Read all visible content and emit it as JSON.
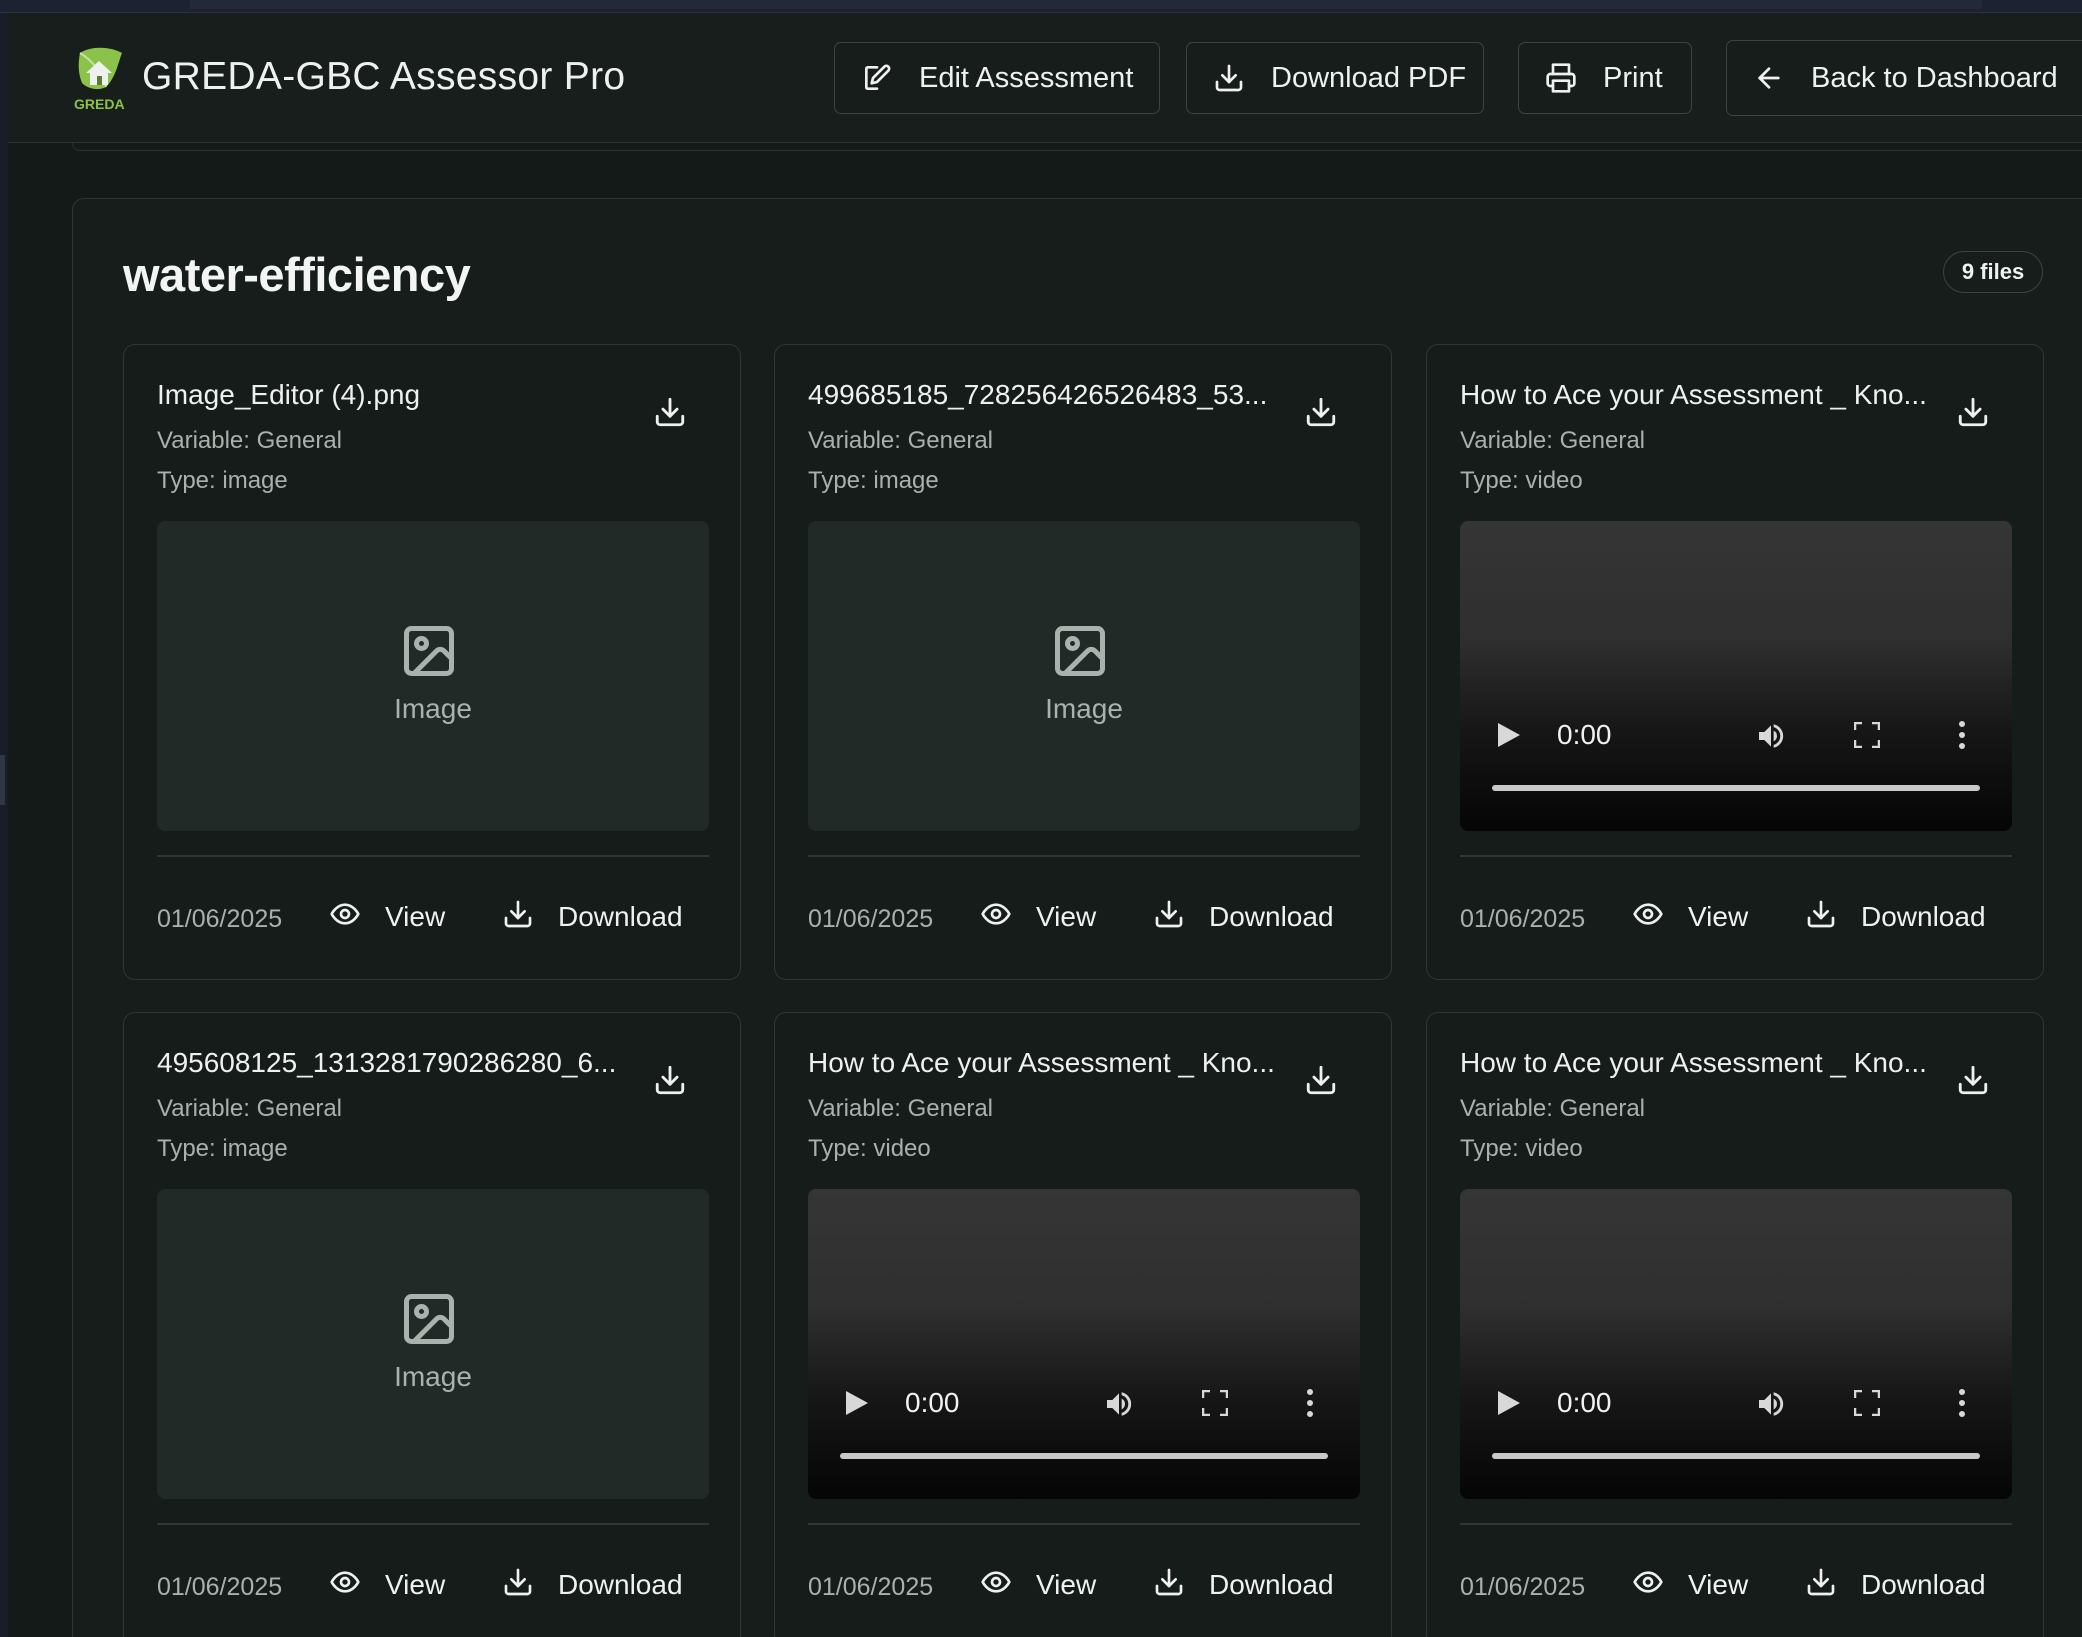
{
  "header": {
    "app_title": "GREDA-GBC Assessor Pro",
    "logo_text": "GREDA",
    "buttons": {
      "edit": "Edit Assessment",
      "download_pdf": "Download PDF",
      "print": "Print",
      "back": "Back to Dashboard"
    }
  },
  "section": {
    "title": "water-efficiency",
    "file_count": "9 files"
  },
  "labels": {
    "view": "View",
    "download": "Download",
    "image_placeholder": "Image"
  },
  "files": [
    {
      "name": "Image_Editor (4).png",
      "variable": "Variable: General",
      "type": "Type: image",
      "kind": "image",
      "date": "01/06/2025"
    },
    {
      "name": "499685185_728256426526483_53...",
      "variable": "Variable: General",
      "type": "Type: image",
      "kind": "image",
      "date": "01/06/2025"
    },
    {
      "name": "How to Ace your Assessment _ Kno...",
      "variable": "Variable: General",
      "type": "Type: video",
      "kind": "video",
      "date": "01/06/2025",
      "time": "0:00"
    },
    {
      "name": "495608125_1313281790286280_6...",
      "variable": "Variable: General",
      "type": "Type: image",
      "kind": "image",
      "date": "01/06/2025"
    },
    {
      "name": "How to Ace your Assessment _ Kno...",
      "variable": "Variable: General",
      "type": "Type: video",
      "kind": "video",
      "date": "01/06/2025",
      "time": "0:00"
    },
    {
      "name": "How to Ace your Assessment _ Kno...",
      "variable": "Variable: General",
      "type": "Type: video",
      "kind": "video",
      "date": "01/06/2025",
      "time": "0:00"
    }
  ],
  "colors": {
    "background": "#141a18",
    "card_border": "#2e3935",
    "logo_green": "#8bc34a"
  }
}
